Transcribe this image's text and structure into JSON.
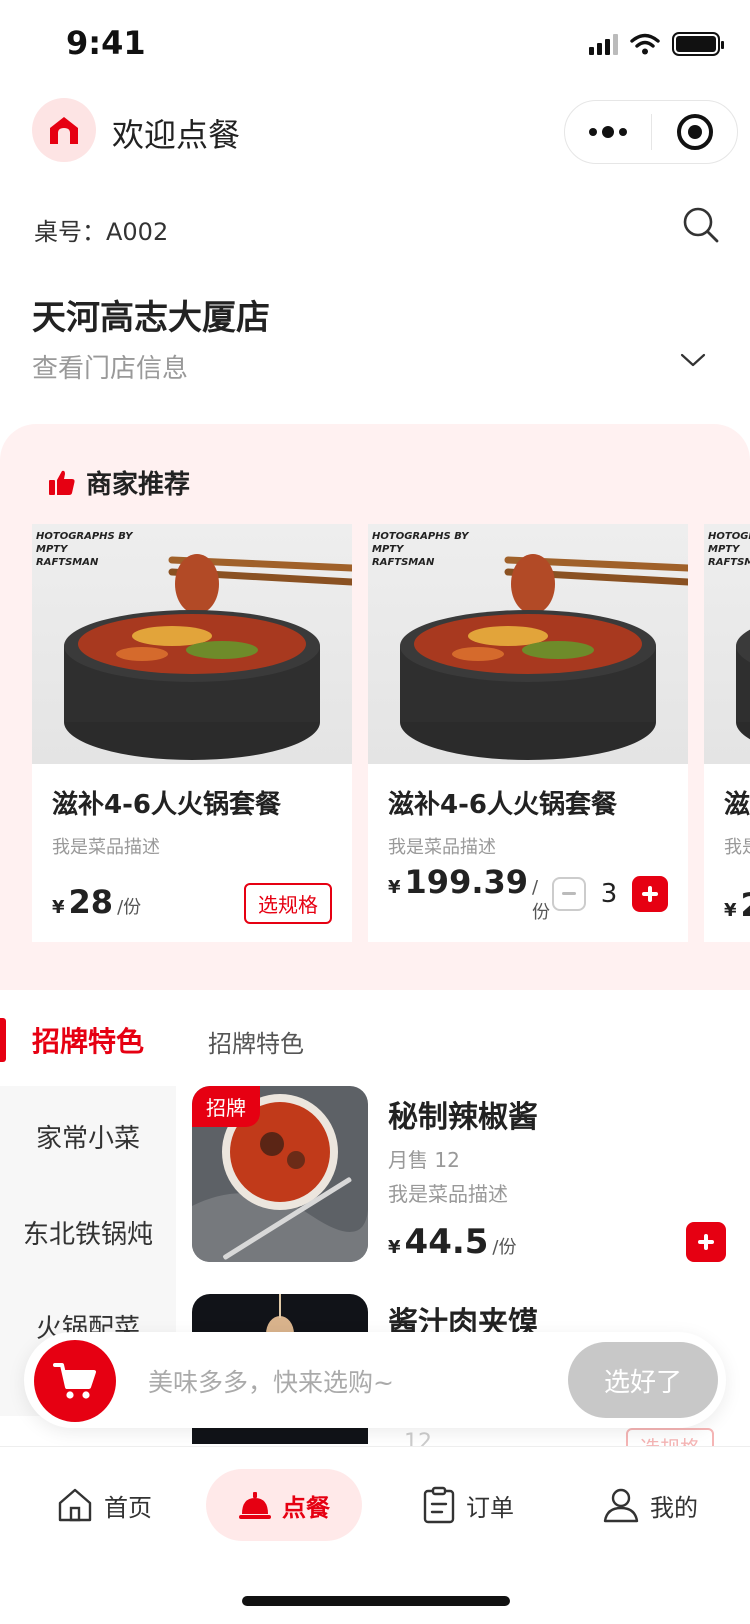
{
  "status_bar": {
    "time": "9:41"
  },
  "header": {
    "title": "欢迎点餐"
  },
  "table": {
    "label": "桌号：A002"
  },
  "store": {
    "name": "天河高志大厦店",
    "info_link": "查看门店信息"
  },
  "recommend": {
    "title": "商家推荐",
    "items": [
      {
        "name": "滋补4-6人火锅套餐",
        "desc": "我是菜品描述",
        "currency": "¥",
        "price": "28",
        "unit": "/份",
        "action": "选规格",
        "watermark": "HOTOGRAPHS BY\nMPTY\nRAFTSMAN"
      },
      {
        "name": "滋补4-6人火锅套餐",
        "desc": "我是菜品描述",
        "currency": "¥",
        "price": "199.39",
        "unit": "/份",
        "qty": "3",
        "watermark": "HOTOGRAPHS BY\nMPTY\nRAFTSMAN"
      },
      {
        "name": "滋",
        "desc": "我是",
        "currency": "¥",
        "price": "2",
        "watermark": "HOTOGR\nMPTY\nRAFTSM"
      }
    ]
  },
  "category_tabs": {
    "active": "招牌特色",
    "other": "招牌特色"
  },
  "sidebar": {
    "items": [
      "家常小菜",
      "东北铁锅炖",
      "火锅配菜"
    ]
  },
  "dishes": [
    {
      "name": "秘制辣椒酱",
      "badge": "招牌",
      "sales": "月售 12",
      "desc": "我是菜品描述",
      "currency": "¥",
      "price": "44.5",
      "unit": "/份"
    },
    {
      "name": "酱汁肉夹馍",
      "sales": "12",
      "action": "选规格"
    }
  ],
  "cart": {
    "placeholder": "美味多多，快来选购~",
    "confirm": "选好了"
  },
  "tabbar": {
    "items": [
      "首页",
      "点餐",
      "订单",
      "我的"
    ]
  },
  "colors": {
    "accent": "#e60012",
    "rec_bg": "#fff1f1"
  }
}
